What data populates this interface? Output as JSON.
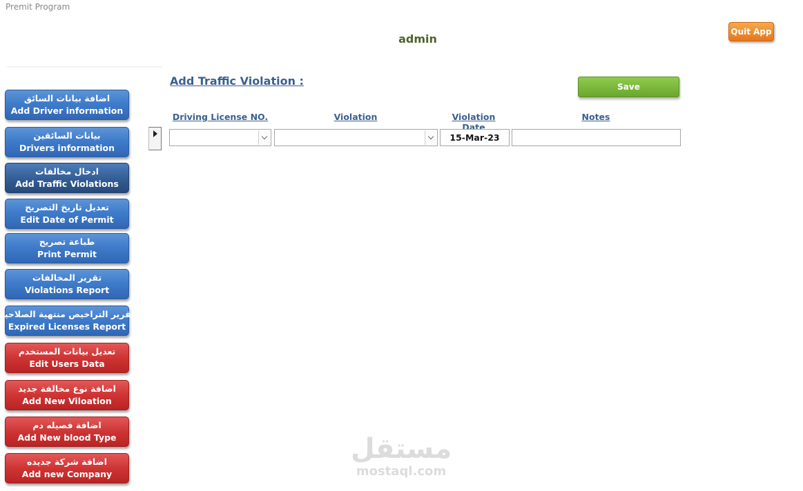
{
  "window": {
    "title": "Premit Program"
  },
  "header": {
    "user": "admin",
    "quit_label": "Quit App"
  },
  "sidebar": {
    "items": [
      {
        "ar": "اضافة بيانات السائق",
        "en": "Add Driver information",
        "color": "blue"
      },
      {
        "ar": "بيانات السائقين",
        "en": "Drivers information",
        "color": "blue"
      },
      {
        "ar": "ادخال مخالفات",
        "en": "Add Traffic Violations",
        "color": "active"
      },
      {
        "ar": "تعديل تاريخ التصريح",
        "en": "Edit Date of Permit",
        "color": "blue"
      },
      {
        "ar": "طباعة تصريح",
        "en": "Print Permit",
        "color": "blue"
      },
      {
        "ar": "تقرير المخالفات",
        "en": "Violations Report",
        "color": "blue"
      },
      {
        "ar": "تقرير التراخيص منتهية الصلاحية",
        "en": "Expired Licenses Report",
        "color": "blue"
      },
      {
        "ar": "تعديل بيانات المستخدم",
        "en": "Edit Users Data",
        "color": "red"
      },
      {
        "ar": "اضافة نوع مخالفة جديد",
        "en": "Add New Viloation",
        "color": "red"
      },
      {
        "ar": "اضافة فصيله دم",
        "en": "Add New blood Type",
        "color": "red"
      },
      {
        "ar": "اضافة شركة جديده",
        "en": "Add new Company",
        "color": "red"
      }
    ]
  },
  "form": {
    "title": "Add Traffic Violation :",
    "save_label": "Save",
    "columns": {
      "license": "Driving License NO.",
      "violation": "Violation",
      "date": "Violation Date",
      "notes": "Notes"
    },
    "row": {
      "license": "",
      "violation": "",
      "date": "15-Mar-23",
      "notes": ""
    }
  },
  "watermark": {
    "ar": "مستقل",
    "en": "mostaql.com"
  },
  "colors": {
    "nav_blue": "#3f7ccb",
    "nav_active": "#355f97",
    "nav_red": "#cf3434",
    "save_green": "#6aa72d",
    "quit_orange": "#e5781b",
    "heading_blue": "#3a5f8f",
    "user_green": "#4f6228"
  }
}
